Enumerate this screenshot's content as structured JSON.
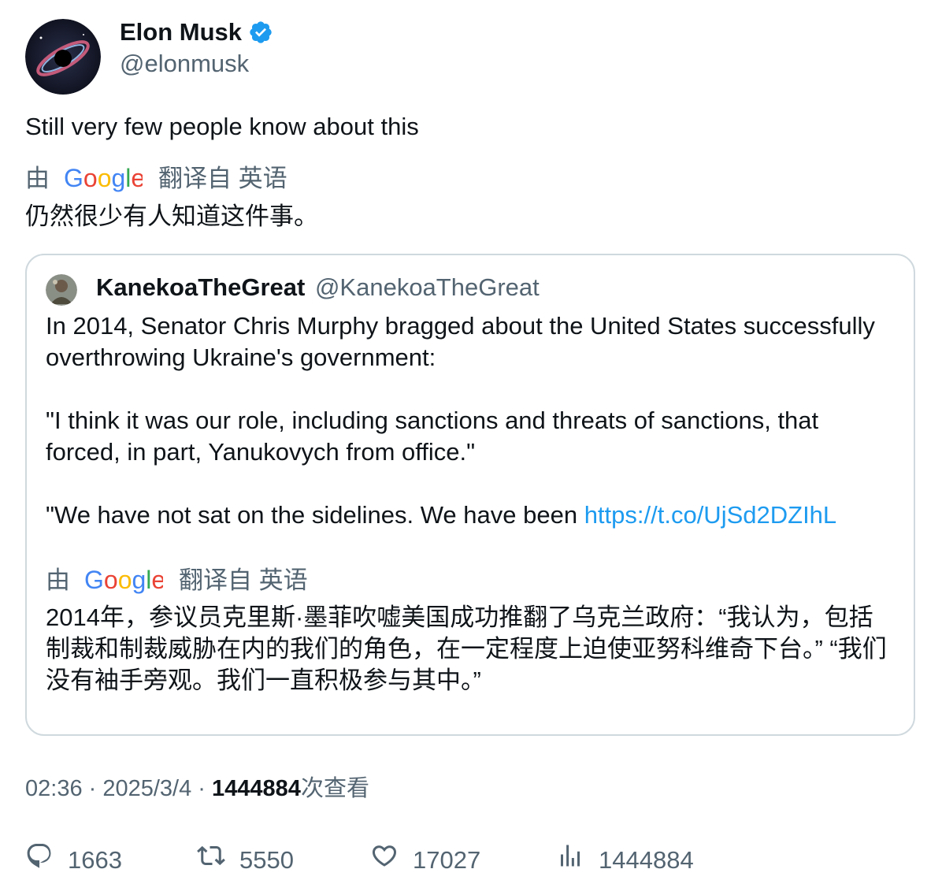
{
  "author": {
    "display_name": "Elon Musk",
    "handle": "@elonmusk",
    "verified": true
  },
  "tweet": {
    "text": "Still very few people know about this",
    "translation_by": "由",
    "translation_label": "翻译自 英语",
    "translated_text": "仍然很少有人知道这件事。"
  },
  "quoted_tweet": {
    "display_name": "KanekoaTheGreat",
    "handle": "@KanekoaTheGreat",
    "paragraph_1": "In 2014, Senator Chris Murphy bragged about the United States successfully overthrowing Ukraine's government:",
    "paragraph_2": "\"I think it was our role, including sanctions and threats of sanctions, that forced, in part, Yanukovych from office.\"",
    "paragraph_3": "\"We have not sat on the sidelines. We have been ",
    "link": "https://t.co/UjSd2DZIhL",
    "translation_by": "由",
    "translation_label": "翻译自 英语",
    "translated_text": "2014年，参议员克里斯·墨菲吹嘘美国成功推翻了乌克兰政府：“我认为，包括制裁和制裁威胁在内的我们的角色，在一定程度上迫使亚努科维奇下台。” “我们没有袖手旁观。我们一直积极参与其中。”"
  },
  "meta": {
    "time": "02:36",
    "separator": " · ",
    "date": "2025/3/4",
    "views_count": "1444884",
    "views_label": "次查看"
  },
  "actions": {
    "replies": "1663",
    "retweets": "5550",
    "likes": "17027",
    "views": "1444884"
  },
  "colors": {
    "accent": "#1d9bf0",
    "secondary_text": "#536471",
    "border": "#cfd9de"
  },
  "icons": [
    "verified-badge-icon",
    "google-logo",
    "reply-icon",
    "retweet-icon",
    "like-icon",
    "views-icon"
  ]
}
